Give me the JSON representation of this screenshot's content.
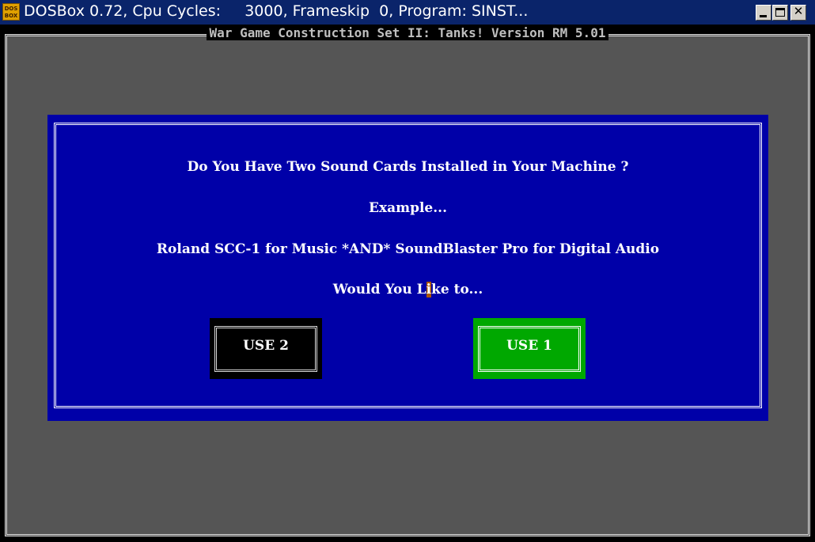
{
  "window": {
    "icon_line1": "DOS",
    "icon_line2": "BOX",
    "title": "DOSBox 0.72, Cpu Cycles:     3000, Frameskip  0, Program: SINST..."
  },
  "app": {
    "title": "War Game Construction Set II: Tanks! Version RM 5.01"
  },
  "dialog": {
    "question": "Do You Have Two Sound Cards Installed in Your Machine ?",
    "example": "Example...",
    "detail": "Roland SCC-1 for Music *AND* SoundBlaster Pro for Digital Audio",
    "prompt_before_cursor": "Would You L",
    "prompt_cursor_char": "i",
    "prompt_after_cursor": "ke to...",
    "buttons": {
      "use2": "USE 2",
      "use1": "USE 1"
    },
    "colors": {
      "dialog_bg": "#0000a8",
      "selected_button": "#00a800",
      "unselected_button": "#000000",
      "cursor": "#a85400"
    }
  }
}
